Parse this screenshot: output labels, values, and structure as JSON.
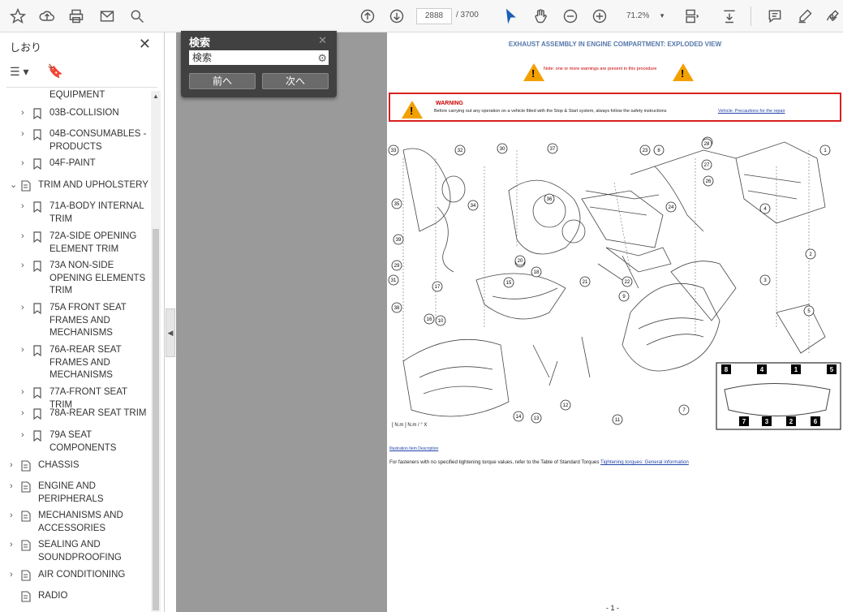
{
  "toolbar": {
    "page_current": "2888",
    "page_total": "/ 3700",
    "zoom": "71.2%"
  },
  "sidebar": {
    "title": "しおり",
    "items": [
      {
        "label": "EQUIPMENT",
        "chev": "",
        "icon": "none"
      },
      {
        "label": "03B-COLLISION",
        "chev": "›",
        "icon": "bookmark"
      },
      {
        "label": "04B-CONSUMABLES - PRODUCTS",
        "chev": "›",
        "icon": "bookmark"
      },
      {
        "label": "04F-PAINT",
        "chev": "›",
        "icon": "bookmark"
      },
      {
        "label": "TRIM AND UPHOLSTERY",
        "chev": "⌄",
        "icon": "doc"
      },
      {
        "label": "71A-BODY INTERNAL TRIM",
        "chev": "›",
        "icon": "bookmark"
      },
      {
        "label": "72A-SIDE OPENING ELEMENT TRIM",
        "chev": "›",
        "icon": "bookmark"
      },
      {
        "label": "73A NON-SIDE OPENING ELEMENTS TRIM",
        "chev": "›",
        "icon": "bookmark"
      },
      {
        "label": "75A FRONT SEAT FRAMES AND MECHANISMS",
        "chev": "›",
        "icon": "bookmark"
      },
      {
        "label": "76A-REAR SEAT FRAMES AND MECHANISMS",
        "chev": "›",
        "icon": "bookmark"
      },
      {
        "label": "77A-FRONT SEAT TRIM",
        "chev": "›",
        "icon": "bookmark"
      },
      {
        "label": "78A-REAR SEAT TRIM",
        "chev": "›",
        "icon": "bookmark"
      },
      {
        "label": "79A SEAT COMPONENTS",
        "chev": "›",
        "icon": "bookmark"
      },
      {
        "label": "CHASSIS",
        "chev": "›",
        "icon": "doc"
      },
      {
        "label": "ENGINE AND PERIPHERALS",
        "chev": "›",
        "icon": "doc"
      },
      {
        "label": "MECHANISMS AND ACCESSORIES",
        "chev": "›",
        "icon": "doc"
      },
      {
        "label": "SEALING AND SOUNDPROOFING",
        "chev": "›",
        "icon": "doc"
      },
      {
        "label": "AIR CONDITIONING",
        "chev": "›",
        "icon": "doc"
      },
      {
        "label": "RADIO",
        "chev": "",
        "icon": "doc"
      }
    ]
  },
  "search": {
    "title": "検索",
    "input_value": "検索",
    "prev_label": "前へ",
    "next_label": "次へ"
  },
  "page": {
    "title": "EXHAUST ASSEMBLY IN ENGINE COMPARTMENT: EXPLODED VIEW",
    "warning_note": "Note: one or more warnings are present in this procedure",
    "warning_title": "WARNING",
    "warning_body": "Before carrying out any operation on a vehicle fitted with the Stop & Start system, always follow the safety instructions",
    "warning_link": "Vehicle: Precautions for the repair",
    "illustration_link": "Illustration Item Description",
    "note_text": "For fasteners with no specified tightening torque values, refer to the Table of Standard Torques",
    "note_link": "Tightening torques: General information",
    "torque_legend": "[ N.m ] N.m / ° X",
    "page_number": "- 1 -"
  },
  "callouts": [
    "1",
    "2",
    "3",
    "4",
    "5",
    "6",
    "7",
    "8",
    "9",
    "10",
    "11",
    "12",
    "13",
    "14",
    "15",
    "16",
    "17",
    "18",
    "19",
    "20",
    "21",
    "22",
    "23",
    "24",
    "25",
    "26",
    "27",
    "28",
    "29",
    "30",
    "31",
    "32",
    "33",
    "34",
    "35",
    "36",
    "37",
    "38",
    "39"
  ],
  "inset_numbers": [
    "8",
    "4",
    "1",
    "5",
    "7",
    "3",
    "2",
    "6"
  ]
}
